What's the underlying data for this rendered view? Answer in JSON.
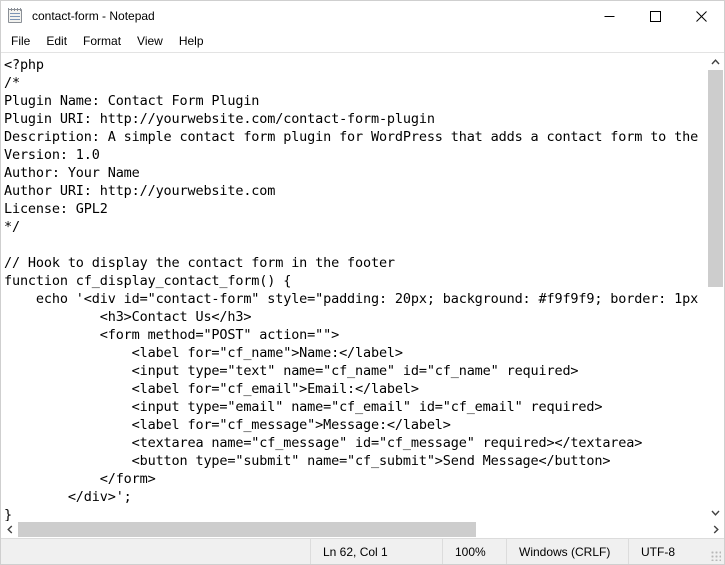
{
  "window": {
    "title": "contact-form - Notepad",
    "icon": "notepad-icon",
    "minimize_label": "Minimize",
    "maximize_label": "Maximize",
    "close_label": "Close"
  },
  "menubar": {
    "items": [
      {
        "label": "File"
      },
      {
        "label": "Edit"
      },
      {
        "label": "Format"
      },
      {
        "label": "View"
      },
      {
        "label": "Help"
      }
    ]
  },
  "editor": {
    "content": "<?php\n/*\nPlugin Name: Contact Form Plugin\nPlugin URI: http://yourwebsite.com/contact-form-plugin\nDescription: A simple contact form plugin for WordPress that adds a contact form to the\nVersion: 1.0\nAuthor: Your Name\nAuthor URI: http://yourwebsite.com\nLicense: GPL2\n*/\n\n// Hook to display the contact form in the footer\nfunction cf_display_contact_form() {\n    echo '<div id=\"contact-form\" style=\"padding: 20px; background: #f9f9f9; border: 1px\n            <h3>Contact Us</h3>\n            <form method=\"POST\" action=\"\">\n                <label for=\"cf_name\">Name:</label>\n                <input type=\"text\" name=\"cf_name\" id=\"cf_name\" required>\n                <label for=\"cf_email\">Email:</label>\n                <input type=\"email\" name=\"cf_email\" id=\"cf_email\" required>\n                <label for=\"cf_message\">Message:</label>\n                <textarea name=\"cf_message\" id=\"cf_message\" required></textarea>\n                <button type=\"submit\" name=\"cf_submit\">Send Message</button>\n            </form>\n        </div>';\n}"
  },
  "scrollbars": {
    "vertical": {
      "up_arrow": "scroll-up-arrow",
      "down_arrow": "scroll-down-arrow",
      "thumb_top_pct": 0,
      "thumb_height_pct": 50
    },
    "horizontal": {
      "left_arrow": "scroll-left-arrow",
      "right_arrow": "scroll-right-arrow",
      "thumb_left_pct": 0,
      "thumb_width_pct": 66.5
    }
  },
  "statusbar": {
    "cursor_position": "Ln 62, Col 1",
    "zoom": "100%",
    "line_endings": "Windows (CRLF)",
    "encoding": "UTF-8"
  }
}
